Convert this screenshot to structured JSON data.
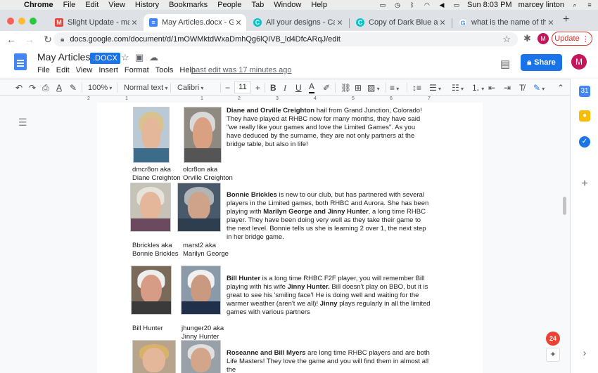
{
  "os_menubar": {
    "app": "Chrome",
    "items": [
      "File",
      "Edit",
      "View",
      "History",
      "Bookmarks",
      "People",
      "Tab",
      "Window",
      "Help"
    ],
    "datetime": "Sun 8:03 PM",
    "user": "marcey linton"
  },
  "tabs": [
    {
      "label": "Slight Update - marceylinto",
      "icon": "gmail-icon",
      "color": "#ea4335",
      "active": false
    },
    {
      "label": "May Articles.docx - Google",
      "icon": "docs-icon",
      "color": "#4285f4",
      "active": true
    },
    {
      "label": "All your designs - Canva",
      "icon": "canva-icon",
      "color": "#00c4cc",
      "active": false
    },
    {
      "label": "Copy of Dark Blue and Oran",
      "icon": "canva-icon",
      "color": "#00c4cc",
      "active": false
    },
    {
      "label": "what is the name of the cha",
      "icon": "google-icon",
      "color": "#4285f4",
      "active": false
    }
  ],
  "address_bar": {
    "url": "docs.google.com/document/d/1mOWMktdWxaDmhQg6lQIVB_ld4DfcARqJ/edit",
    "update_label": "Update",
    "profile_initial": "M"
  },
  "docs": {
    "title": "May Articles",
    "badge": ".DOCX",
    "menus": [
      "File",
      "Edit",
      "View",
      "Insert",
      "Format",
      "Tools",
      "Help"
    ],
    "last_edit": "Last edit was 17 minutes ago",
    "share_label": "Share",
    "avatar_initial": "M"
  },
  "format_toolbar": {
    "zoom": "100%",
    "style": "Normal text",
    "font": "Calibri",
    "font_size": "11"
  },
  "ruler": {
    "ticks": [
      "2",
      "1",
      "1",
      "2",
      "3",
      "4",
      "5",
      "6",
      "7"
    ]
  },
  "document": {
    "sections": [
      {
        "captions": [
          [
            "dmcr8on aka",
            "Diane Creighton"
          ],
          [
            "olcr8on aka",
            "Orville Creighton"
          ]
        ],
        "paragraph_bold": "Diane and Orville Creighton",
        "paragraph": " hail from Grand Junction, Colorado! They have played at RHBC now for many months, they have said \"we really like your games and love the Limited Games\".  As you have deduced by the surname, they are not only partners at the bridge table, but also in life!"
      },
      {
        "captions": [
          [
            "Bbrickles aka",
            "Bonnie Brickles"
          ],
          [
            "marst2 aka",
            "Marilyn George"
          ]
        ],
        "paragraph_bold": "Bonnie Brickles",
        "paragraph": " is new to our club, but has partnered with several players in the Limited games, both RHBC and Aurora.  She has been playing with ",
        "paragraph_bold2": "Marilyn George and Jinny Hunter",
        "paragraph2": ", a long time RHBC player. They have been doing very well as they take their game to the next level.  Bonnie tells us she is learning 2 over 1, the next step in her bridge game."
      },
      {
        "captions": [
          [
            "Bill Hunter",
            ""
          ],
          [
            "jhunger20 aka",
            "Jinny Hunter"
          ]
        ],
        "paragraph_bold": "Bill Hunter",
        "paragraph": " is a long time RHBC F2F player, you will remember Bill playing with his wife ",
        "paragraph_bold2": "Jinny Hunter.",
        "paragraph2": " Bill doesn't play on BBO, but it is great to see his 'smiling face'! He is doing well and waiting for the warmer weather (aren't we all)! ",
        "paragraph_bold3": "Jinny",
        "paragraph3": " plays regularly in all the limited games with various partners"
      },
      {
        "paragraph_bold": "Roseanne and Bill Myers",
        "paragraph": " are long time RHBC players and are both Life Masters!  They love the game and you will find them in almost all the"
      }
    ]
  },
  "side_panel": {
    "notification_count": "24"
  }
}
